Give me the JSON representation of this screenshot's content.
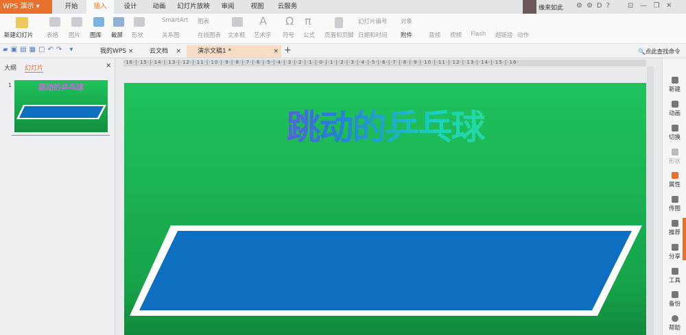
{
  "app": {
    "name": "WPS 演示",
    "user": "缘来如此"
  },
  "menu_tabs": [
    "开始",
    "插入",
    "设计",
    "动画",
    "幻灯片放映",
    "审阅",
    "视图",
    "云服务"
  ],
  "ribbon": {
    "new_slide": "新建幻灯片",
    "table": "表格",
    "picture": "图片",
    "gallery": "图库",
    "screenshot": "截屏",
    "shape": "形状",
    "smartart": "SmartArt",
    "chart": "图表",
    "relation": "关系图",
    "online_chart": "在线图表",
    "textbox": "文本框",
    "wordart": "艺术字",
    "symbol": "符号",
    "formula": "公式",
    "header_footer": "页眉和页脚",
    "slide_number": "幻灯片编号",
    "object": "对象",
    "datetime": "日期和时间",
    "attachment": "附件",
    "audio": "音频",
    "video": "视频",
    "flash": "Flash",
    "hyperlink": "超链接",
    "action": "动作"
  },
  "doc_tabs": [
    "我的WPS",
    "云文档",
    "演示文稿1 *"
  ],
  "search_command": "点此查找命令",
  "left_panel": {
    "tabs": [
      "大纲",
      "幻灯片"
    ],
    "slide_number": "1"
  },
  "ruler": "·16·|·15·|·14·|·13·|·12·|·11·|·10·|·9·|·8·|·7·|·6·|·5·|·4·|·3·|·2·|·1·|·0·|·1·|·2·|·3·|·4·|·5·|·6·|·7·|·8·|·9·|·10·|·11·|·12·|·13·|·14·|·15·|·16·",
  "slide": {
    "title": "跳动的乒乓球"
  },
  "right_sidebar": [
    "新建",
    "动画",
    "切换",
    "形状",
    "属性",
    "传图",
    "推荐",
    "分享",
    "工具",
    "备份",
    "帮助"
  ],
  "colors": {
    "accent": "#e8712e",
    "slide_green": "#1fc35c",
    "table_blue": "#0e6fc0"
  }
}
